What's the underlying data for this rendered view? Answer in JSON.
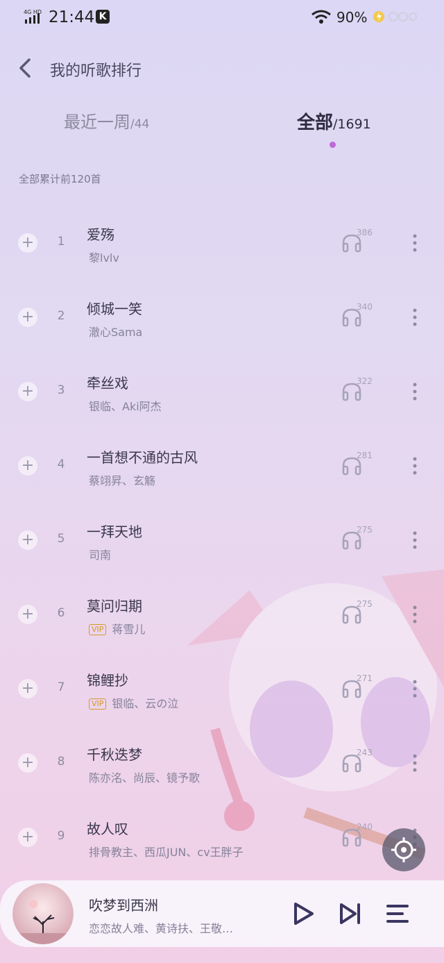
{
  "status_bar": {
    "network": "4G HD",
    "time": "21:44",
    "app_badge": "K",
    "battery": "90%"
  },
  "header": {
    "title": "我的听歌排行"
  },
  "tabs": [
    {
      "label": "最近一周",
      "count": "/44"
    },
    {
      "label": "全部",
      "count": "/1691"
    }
  ],
  "subtitle": "全部累计前120首",
  "songs": [
    {
      "rank": "1",
      "title": "爱殇",
      "artist": "黎lvlv",
      "vip": false,
      "plays": "386"
    },
    {
      "rank": "2",
      "title": "倾城一笑",
      "artist": "澈心Sama",
      "vip": false,
      "plays": "340"
    },
    {
      "rank": "3",
      "title": "牵丝戏",
      "artist": "银临、Aki阿杰",
      "vip": false,
      "plays": "322"
    },
    {
      "rank": "4",
      "title": "一首想不通的古风",
      "artist": "蔡翊昇、玄觞",
      "vip": false,
      "plays": "281"
    },
    {
      "rank": "5",
      "title": "一拜天地",
      "artist": "司南",
      "vip": false,
      "plays": "275"
    },
    {
      "rank": "6",
      "title": "莫问归期",
      "artist": "蒋雪儿",
      "vip": true,
      "plays": "275"
    },
    {
      "rank": "7",
      "title": "锦鲤抄",
      "artist": "银临、云の泣",
      "vip": true,
      "plays": "271"
    },
    {
      "rank": "8",
      "title": "千秋迭梦",
      "artist": "陈亦洺、尚辰、镜予歌",
      "vip": false,
      "plays": "243"
    },
    {
      "rank": "9",
      "title": "故人叹",
      "artist": "排骨教主、西瓜JUN、cv王胖子",
      "vip": false,
      "plays": "240"
    }
  ],
  "vip_label": "VIP",
  "add_label": "+",
  "player": {
    "title": "吹梦到西洲",
    "artist": "恋恋故人难、黄诗扶、王敬…"
  },
  "colors": {
    "accent": "#c067d8",
    "vip": "#d79a2c"
  }
}
